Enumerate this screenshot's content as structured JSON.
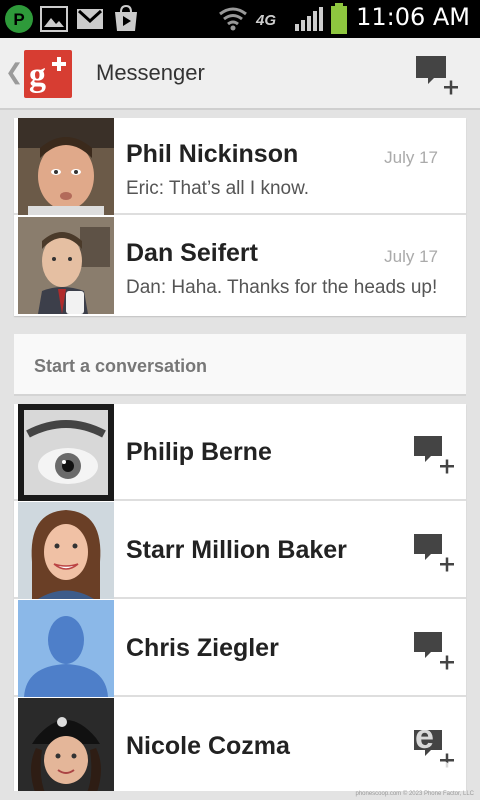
{
  "status_bar": {
    "time": "11:06 AM",
    "network": "4G",
    "icons": [
      "pandora-icon",
      "gallery-icon",
      "gmail-icon",
      "play-store-icon",
      "wifi-icon",
      "network-4g-icon",
      "signal-icon",
      "battery-icon"
    ]
  },
  "header": {
    "title": "Messenger",
    "logo_text": "g+",
    "accent": "#d73d32"
  },
  "conversations": [
    {
      "name": "Phil Nickinson",
      "date": "July 17",
      "snippet": "Eric: That’s all I know."
    },
    {
      "name": "Dan Seifert",
      "date": "July 17",
      "snippet": "Dan: Haha. Thanks for the heads up!"
    }
  ],
  "start_section": {
    "label": "Start a conversation"
  },
  "contacts": [
    {
      "name": "Philip Berne"
    },
    {
      "name": "Starr Million Baker"
    },
    {
      "name": "Chris Ziegler"
    },
    {
      "name": "Nicole Cozma"
    }
  ],
  "watermark": {
    "line1": "Phone",
    "line2": "scoop"
  },
  "footer": {
    "site": "phonescoop.com",
    "copyright": "© 2023 Phone Factor, LLC"
  }
}
